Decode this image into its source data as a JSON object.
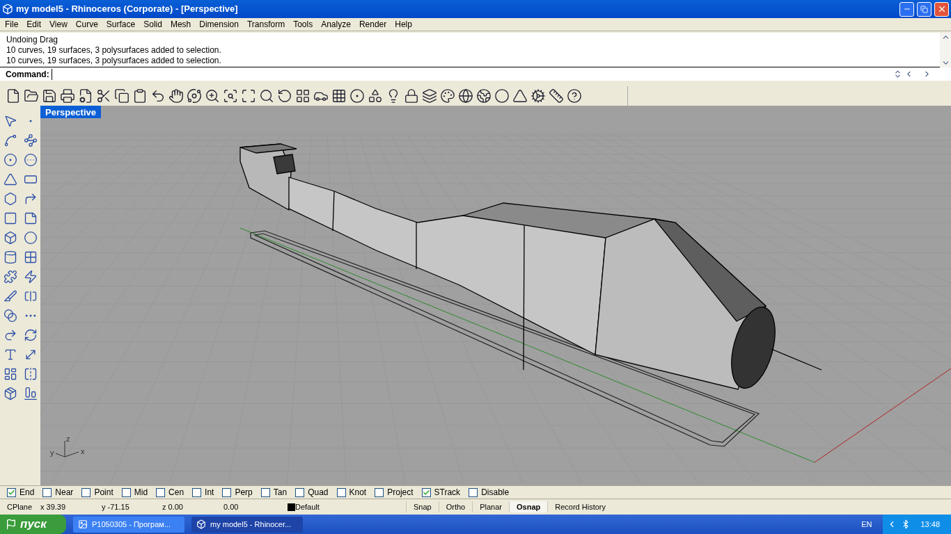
{
  "window": {
    "title": "my model5 - Rhinoceros (Corporate) - [Perspective]"
  },
  "menu": [
    "File",
    "Edit",
    "View",
    "Curve",
    "Surface",
    "Solid",
    "Mesh",
    "Dimension",
    "Transform",
    "Tools",
    "Analyze",
    "Render",
    "Help"
  ],
  "command_history": [
    "Undoing Drag",
    "10 curves, 19 surfaces, 3 polysurfaces added to selection.",
    "10 curves, 19 surfaces, 3 polysurfaces added to selection."
  ],
  "command_prompt": {
    "label": "Command:"
  },
  "viewport": {
    "title": "Perspective",
    "selected": true,
    "axis_labels": {
      "z": "z",
      "y": "y",
      "x": "x"
    }
  },
  "osnaps": [
    {
      "label": "End",
      "checked": true
    },
    {
      "label": "Near",
      "checked": false
    },
    {
      "label": "Point",
      "checked": false
    },
    {
      "label": "Mid",
      "checked": false
    },
    {
      "label": "Cen",
      "checked": false
    },
    {
      "label": "Int",
      "checked": false
    },
    {
      "label": "Perp",
      "checked": false
    },
    {
      "label": "Tan",
      "checked": false
    },
    {
      "label": "Quad",
      "checked": false
    },
    {
      "label": "Knot",
      "checked": false
    },
    {
      "label": "Project",
      "checked": false
    },
    {
      "label": "STrack",
      "checked": true
    },
    {
      "label": "Disable",
      "checked": false
    }
  ],
  "status_bar": {
    "cplane": "CPlane",
    "x": "x 39.39",
    "y": "y -71.15",
    "z": "z 0.00",
    "distance": "0.00",
    "layer": {
      "name": "Default",
      "color": "#000000"
    },
    "toggles": [
      {
        "label": "Snap",
        "on": false
      },
      {
        "label": "Ortho",
        "on": false
      },
      {
        "label": "Planar",
        "on": false
      },
      {
        "label": "Osnap",
        "on": true
      },
      {
        "label": "Record History",
        "on": false
      }
    ]
  },
  "taskbar": {
    "start": "пуск",
    "tasks": [
      {
        "label": "P1050305 - Програм...",
        "selected": false
      },
      {
        "label": "my model5 - Rhinocer...",
        "selected": true
      }
    ],
    "language": "EN",
    "clock": "13:48"
  }
}
